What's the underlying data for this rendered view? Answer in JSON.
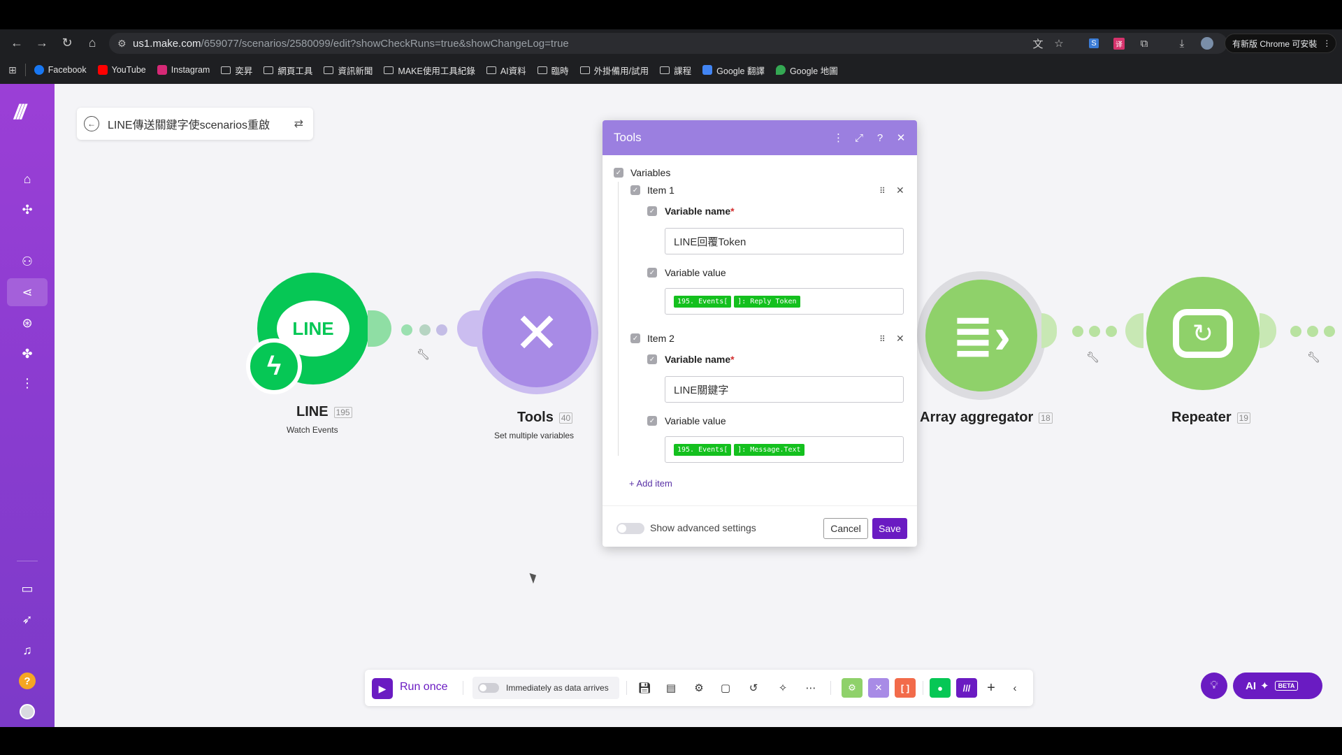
{
  "browser": {
    "url_host": "us1.make.com",
    "url_path": "/659077/scenarios/2580099/edit?showCheckRuns=true&showChangeLog=true",
    "update_label": "有新版 Chrome 可安裝",
    "bookmarks": [
      "Facebook",
      "YouTube",
      "Instagram",
      "奕昇",
      "網頁工具",
      "資訊新聞",
      "MAKE使用工具紀錄",
      "AI資料",
      "臨時",
      "外掛備用/試用",
      "課程",
      "Google 翻譯",
      "Google 地圖"
    ]
  },
  "scenario": {
    "title": "LINE傳送關鍵字使scenarios重啟"
  },
  "modules": {
    "line": {
      "name": "LINE",
      "id": "195",
      "subtitle": "Watch Events",
      "logo_text": "LINE",
      "color": "#06c755"
    },
    "tools": {
      "name": "Tools",
      "id": "40",
      "subtitle": "Set multiple variables",
      "color": "#a88be6"
    },
    "aggregator": {
      "name": "Array aggregator",
      "id": "18",
      "color": "#8fd16a"
    },
    "repeater": {
      "name": "Repeater",
      "id": "19",
      "color": "#8fd16a"
    }
  },
  "panel": {
    "title": "Tools",
    "section_label": "Variables",
    "items": [
      {
        "label": "Item 1",
        "name_label": "Variable name",
        "name_value": "LINE回覆Token",
        "value_label": "Variable value",
        "pills": [
          "195. Events[",
          "]: Reply Token"
        ]
      },
      {
        "label": "Item 2",
        "name_label": "Variable name",
        "name_value": "LINE關鍵字",
        "value_label": "Variable value",
        "pills": [
          "195. Events[",
          "]: Message.Text"
        ]
      }
    ],
    "required_mark": "*",
    "add_item": "Add item",
    "advanced_label": "Show advanced settings",
    "cancel": "Cancel",
    "save": "Save"
  },
  "bottombar": {
    "run_once": "Run once",
    "schedule": "Immediately as data arrives"
  },
  "ai": {
    "label": "AI",
    "beta": "BETA"
  },
  "colors": {
    "accent": "#6a1bc2",
    "panel_header": "#9b7fe0",
    "pill_green": "#14c01e",
    "sidebar": "#8a3cd0"
  }
}
